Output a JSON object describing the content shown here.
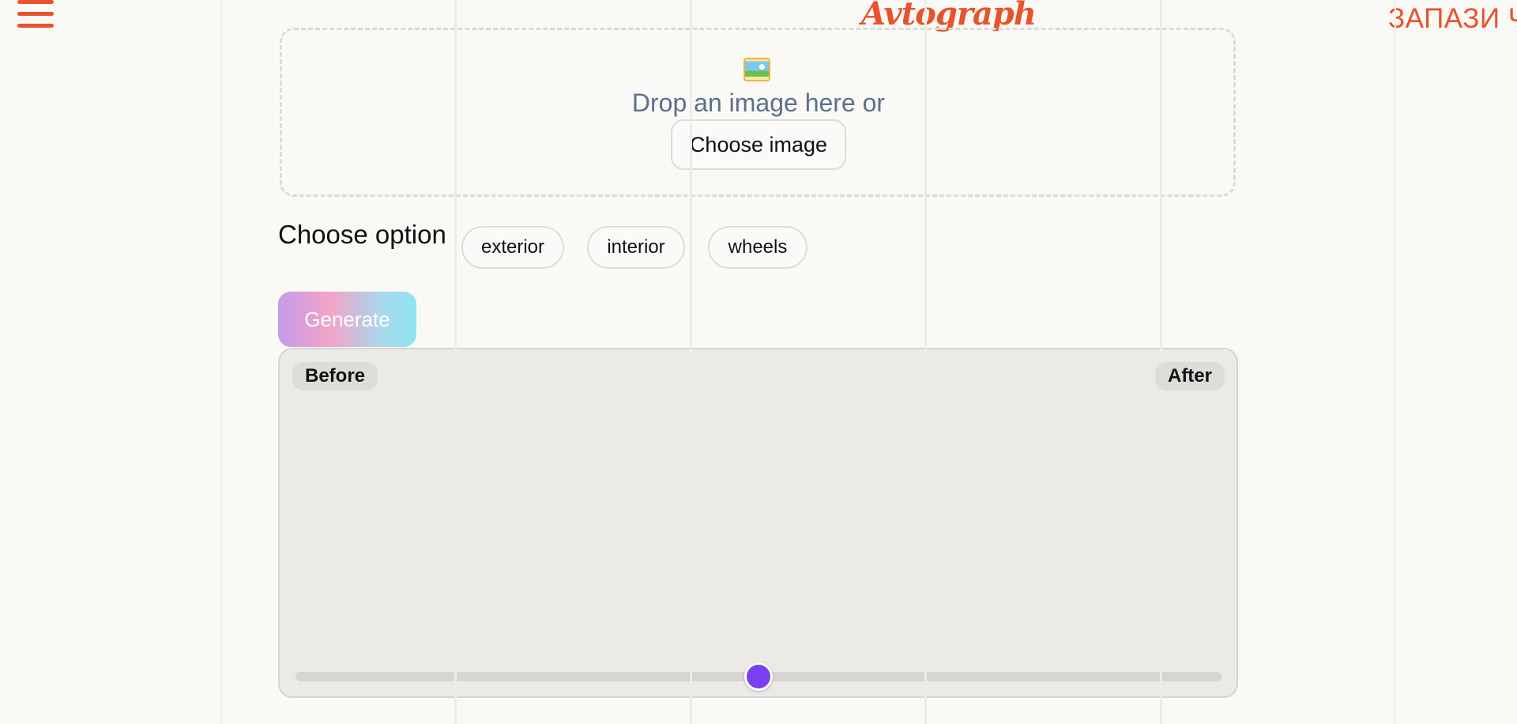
{
  "header": {
    "logo_text": "Avtograph",
    "cta_text": "ЗАПАЗИ Ч",
    "menu_icon": "hamburger-icon"
  },
  "upload": {
    "icon": "framed-picture-icon",
    "prompt": "Drop an image here or",
    "button_label": "Choose image"
  },
  "options": {
    "label": "Choose option",
    "items": [
      {
        "label": "exterior"
      },
      {
        "label": "interior"
      },
      {
        "label": "wheels"
      }
    ]
  },
  "actions": {
    "generate_label": "Generate"
  },
  "compare": {
    "before_label": "Before",
    "after_label": "After",
    "slider_position_percent": 50
  },
  "colors": {
    "brand": "#e8532b",
    "slider_thumb": "#7a3ff0",
    "prompt_text": "#5c6f8c"
  }
}
